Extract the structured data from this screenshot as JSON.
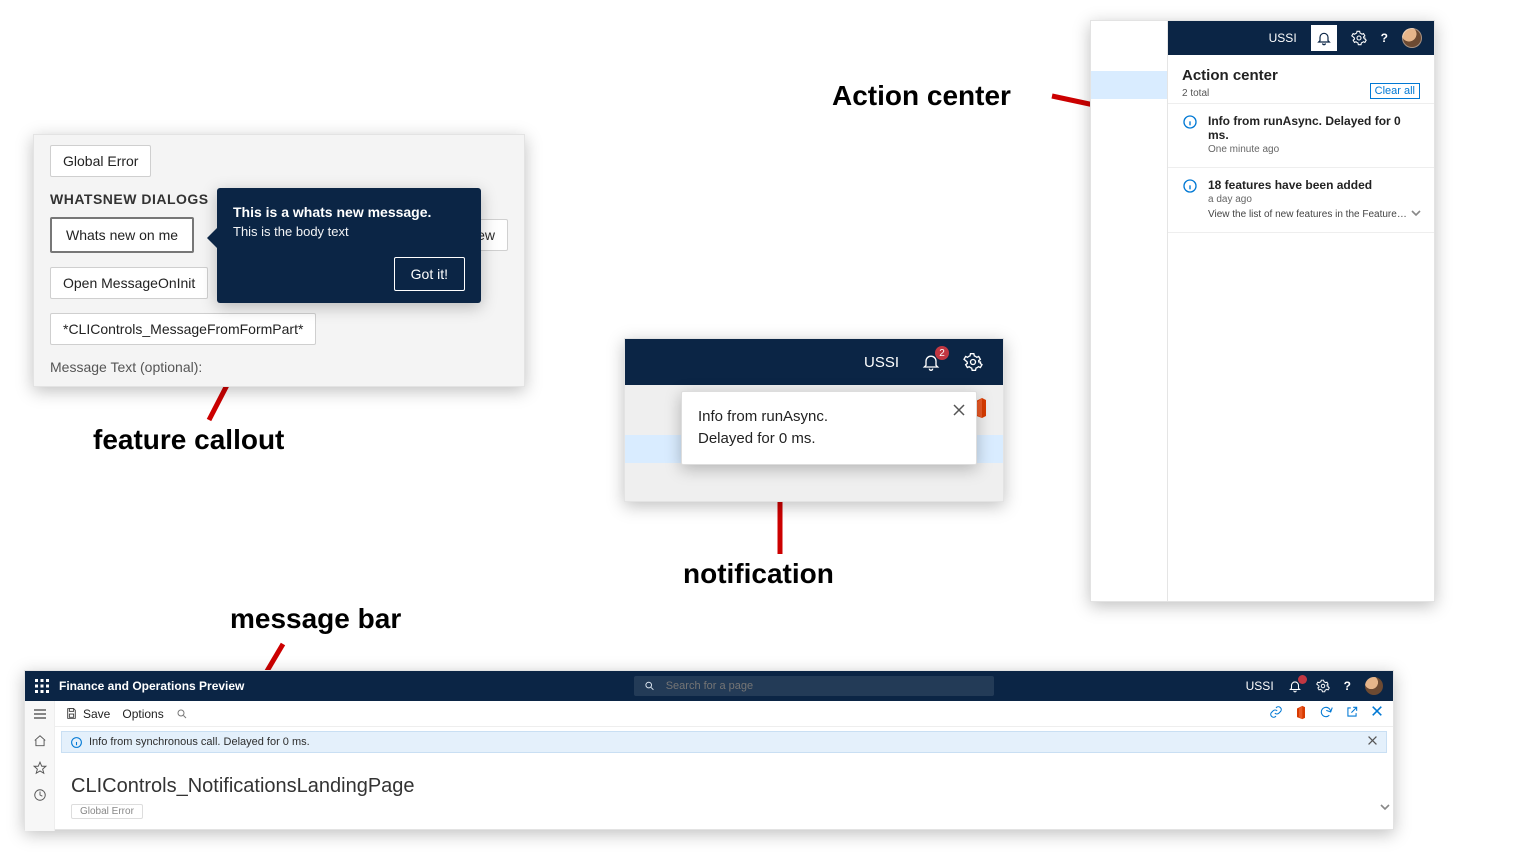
{
  "labels": {
    "feature_callout": "feature callout",
    "notification": "notification",
    "action_center": "Action center",
    "message_bar": "message bar"
  },
  "callout_panel": {
    "global_error_btn": "Global Error",
    "section": "WHATSNEW DIALOGS",
    "whats_new_btn": "Whats new on me",
    "open_msg_btn": "Open MessageOnInit",
    "cli_btn": "*CLIControls_MessageFromFormPart*",
    "ghost_btn": "ts new",
    "optional_label": "Message Text (optional):"
  },
  "tooltip": {
    "title": "This is a whats new message.",
    "body": "This is the body text",
    "gotit": "Got it!"
  },
  "notif": {
    "ussi": "USSI",
    "badge": "2",
    "line1": "Info from runAsync.",
    "line2": "Delayed for 0 ms."
  },
  "action_center": {
    "ussi": "USSI",
    "title": "Action center",
    "total": "2 total",
    "clear_all": "Clear all",
    "items": [
      {
        "title": "Info from runAsync. Delayed for 0 ms.",
        "time": "One minute ago",
        "detail": ""
      },
      {
        "title": "18 features have been added",
        "time": "a day ago",
        "detail": "View the list of new features in the Feature manageme..."
      }
    ]
  },
  "page": {
    "app_title": "Finance and Operations Preview",
    "search_placeholder": "Search for a page",
    "ussi": "USSI",
    "save": "Save",
    "options": "Options",
    "msg_text": "Info from synchronous call. Delayed for 0 ms.",
    "heading": "CLIControls_NotificationsLandingPage",
    "pill": "Global Error"
  }
}
